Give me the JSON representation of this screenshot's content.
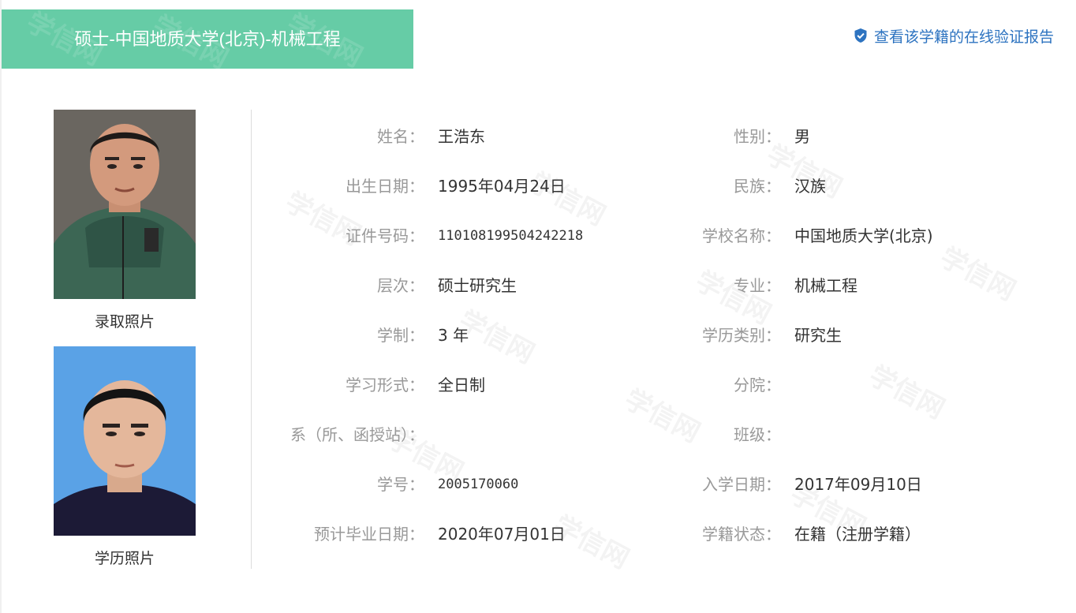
{
  "header": {
    "title": "硕士-中国地质大学(北京)-机械工程",
    "banner_color": "#66cca6",
    "verify_link": "查看该学籍的在线验证报告",
    "verify_icon": "shield-check-icon"
  },
  "photos": {
    "admission_caption": "录取照片",
    "degree_caption": "学历照片"
  },
  "watermark_text": "学信网",
  "fields": [
    {
      "left_label": "姓名：",
      "left_value": "王浩东",
      "right_label": "性别：",
      "right_value": "男"
    },
    {
      "left_label": "出生日期：",
      "left_value": "1995年04月24日",
      "right_label": "民族：",
      "right_value": "汉族"
    },
    {
      "left_label": "证件号码：",
      "left_value": "110108199504242218",
      "right_label": "学校名称：",
      "right_value": "中国地质大学(北京)"
    },
    {
      "left_label": "层次：",
      "left_value": "硕士研究生",
      "right_label": "专业：",
      "right_value": "机械工程"
    },
    {
      "left_label": "学制：",
      "left_value": "3 年",
      "right_label": "学历类别：",
      "right_value": "研究生"
    },
    {
      "left_label": "学习形式：",
      "left_value": "全日制",
      "right_label": "分院：",
      "right_value": ""
    },
    {
      "left_label": "系（所、函授站）：",
      "left_value": "",
      "right_label": "班级：",
      "right_value": ""
    },
    {
      "left_label": "学号：",
      "left_value": "2005170060",
      "right_label": "入学日期：",
      "right_value": "2017年09月10日"
    },
    {
      "left_label": "预计毕业日期：",
      "left_value": "2020年07月01日",
      "right_label": "学籍状态：",
      "right_value": "在籍（注册学籍）"
    }
  ]
}
